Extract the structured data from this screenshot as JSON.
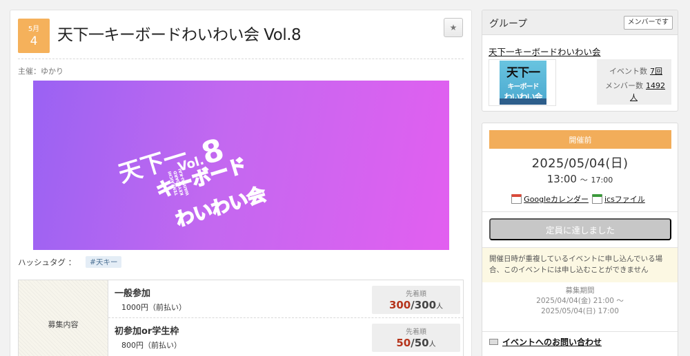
{
  "event": {
    "month": "5月",
    "day": "4",
    "title": "天下一キーボードわいわい会 Vol.8",
    "organizer": "主催：ゆかり",
    "banner": {
      "line1": "天下一",
      "line2": "キーボード",
      "line3": "わいわい会",
      "vol_label": "Vol.",
      "vol_num": "8",
      "sub1": "TENKAICHI",
      "sub2": "KEYBOARD",
      "sub3": "WAIWAI-KAI"
    },
    "hashtag_label": "ハッシュタグ ：",
    "hashtag": "#天キー",
    "recruit_label": "募集内容",
    "tickets": [
      {
        "name": "一般参加",
        "price": "1000円（前払い）",
        "cap_label": "先着順",
        "current": "300",
        "capacity": "/300",
        "unit": "人"
      },
      {
        "name": "初参加or学生枠",
        "price": "800円（前払い）",
        "cap_label": "先着順",
        "current": "50",
        "capacity": "/50",
        "unit": "人"
      }
    ]
  },
  "group": {
    "header": "グループ",
    "member_button": "メンバーです",
    "name": "天下一キーボードわいわい会",
    "thumb": {
      "l1": "天下一",
      "l2": "キーボード",
      "l3": "わいわい会"
    },
    "events_label": "イベント数",
    "events_value": "7回",
    "members_label": "メンバー数",
    "members_value": "1492",
    "members_unit": "人"
  },
  "schedule": {
    "status": "開催前",
    "date": "2025/05/04(日)",
    "time_start": "13:00",
    "time_sep": "～",
    "time_end": "17:00",
    "google_cal": "Googleカレンダー",
    "ics": "icsファイル",
    "full_button": "定員に達しました",
    "warning": "開催日時が重複しているイベントに申し込んでいる場合、このイベントには申し込むことができません",
    "period_label": "募集期間",
    "period_start": "2025/04/04(金) 21:00 ～",
    "period_end": "2025/05/04(日) 17:00",
    "contact": "イベントへのお問い合わせ"
  },
  "colors": {
    "accent_orange": "#f2ad5a",
    "banner_start": "#9a62f3",
    "banner_end": "#e25ff0",
    "count_red": "#b5341b"
  }
}
